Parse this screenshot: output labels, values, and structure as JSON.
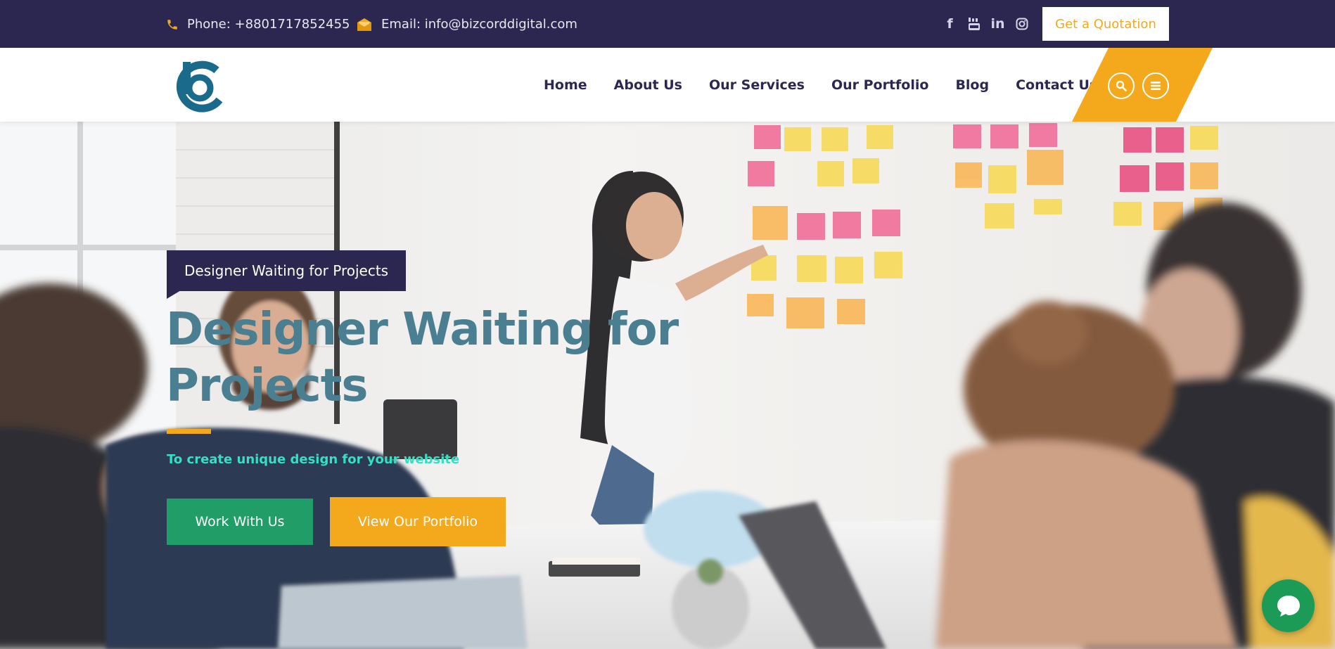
{
  "topbar": {
    "phone": "Phone: +8801717852455",
    "email": "Email: info@bizcorddigital.com",
    "socials": {
      "facebook": "f",
      "youtube": "youtube-icon",
      "linkedin": "in",
      "instagram": "instagram-icon"
    },
    "quote_button": "Get a Quotation"
  },
  "nav": {
    "items": [
      {
        "label": "Home"
      },
      {
        "label": "About Us"
      },
      {
        "label": "Our Services"
      },
      {
        "label": "Our Portfolio"
      },
      {
        "label": "Blog"
      },
      {
        "label": "Contact Us"
      }
    ]
  },
  "hero": {
    "tag": "Designer Waiting for Projects",
    "headline": "Designer Waiting for Projects",
    "subtitle": "To create unique design for your website",
    "primary_button": "Work With Us",
    "secondary_button": "View Our Portfolio"
  },
  "colors": {
    "navy": "#2c2751",
    "accent_yellow": "#f4a81c",
    "green": "#219e68",
    "headline_teal": "#4a7f91",
    "subtitle_aqua": "#35e0c2",
    "logo_blue": "#1a6a8c"
  },
  "icons": [
    "phone-icon",
    "envelope-icon",
    "facebook-icon",
    "youtube-icon",
    "linkedin-icon",
    "instagram-icon",
    "search-icon",
    "menu-icon",
    "chat-icon",
    "logo"
  ]
}
